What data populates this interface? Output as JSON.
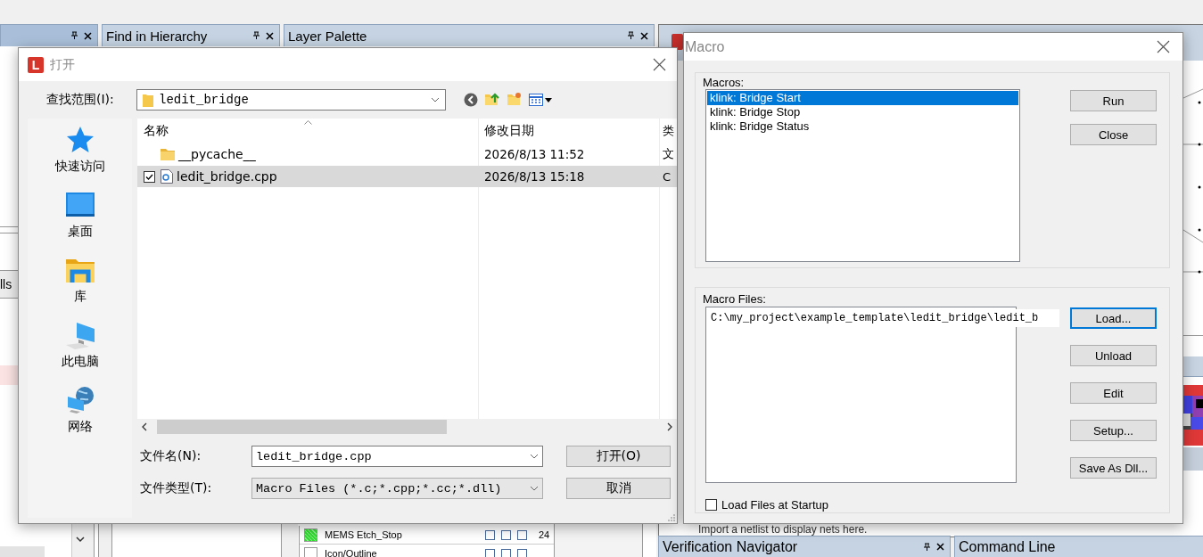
{
  "panel_tabs": [
    {
      "selected": true
    },
    {
      "label": "Find in Hierarchy",
      "selected": false
    },
    {
      "label": "Layer Palette",
      "selected": false
    }
  ],
  "side_tab": "lls",
  "layers": [
    {
      "name": "MEMS Etch_Stop",
      "color": "#33dd33",
      "number": "24",
      "flags": [
        false,
        false,
        false
      ]
    },
    {
      "name": "Icon/Outline",
      "color": "#ffffff",
      "flags": [
        false,
        false,
        false
      ]
    }
  ],
  "hint": "Import a netlist to display nets here.",
  "bottom_tabs": [
    "Verification Navigator",
    "Command Line"
  ],
  "open_dialog": {
    "logo": "L",
    "title": "打开",
    "look_in_label": "查找范围(I):",
    "look_in": "ledit_bridge",
    "places": [
      {
        "label": "快速访问",
        "kind": "star"
      },
      {
        "label": "桌面",
        "kind": "desktop"
      },
      {
        "label": "库",
        "kind": "library"
      },
      {
        "label": "此电脑",
        "kind": "computer"
      },
      {
        "label": "网络",
        "kind": "network"
      }
    ],
    "columns": [
      "名称",
      "修改日期",
      "类"
    ],
    "files": [
      {
        "name": "__pycache__",
        "kind": "folder",
        "modified": "2026/8/13 11:52",
        "column_3": "文",
        "selected": false,
        "checked": false
      },
      {
        "name": "ledit_bridge.cpp",
        "kind": "source",
        "modified": "2026/8/13 15:18",
        "column_3": "C",
        "selected": true,
        "checked": true
      }
    ],
    "file_name_label": "文件名(N):",
    "file_name": "ledit_bridge.cpp",
    "file_type_label": "文件类型(T):",
    "file_type": "Macro Files (*.c;*.cpp;*.cc;*.dll)",
    "buttons": [
      "打开(O)",
      "取消"
    ]
  },
  "macro_dialog": {
    "title": "Macro",
    "macros_label": "Macros:",
    "macros": [
      {
        "name": "klink: Bridge Start",
        "selected": true
      },
      {
        "name": "klink: Bridge Stop",
        "selected": false
      },
      {
        "name": "klink: Bridge Status",
        "selected": false
      }
    ],
    "macro_buttons": [
      "Run",
      "Close"
    ],
    "files_label": "Macro Files:",
    "files": [
      {
        "path": "C:\\my_project\\example_template\\ledit_bridge\\ledit_b",
        "selected": false
      }
    ],
    "file_buttons": [
      {
        "label": "Load...",
        "focused": true
      },
      {
        "label": "Unload",
        "focused": false
      },
      {
        "label": "Edit",
        "focused": false
      },
      {
        "label": "Setup...",
        "focused": false
      },
      {
        "label": "Save As Dll...",
        "focused": false
      }
    ],
    "load_at_startup": {
      "label": "Load Files at Startup",
      "checked": false
    }
  }
}
